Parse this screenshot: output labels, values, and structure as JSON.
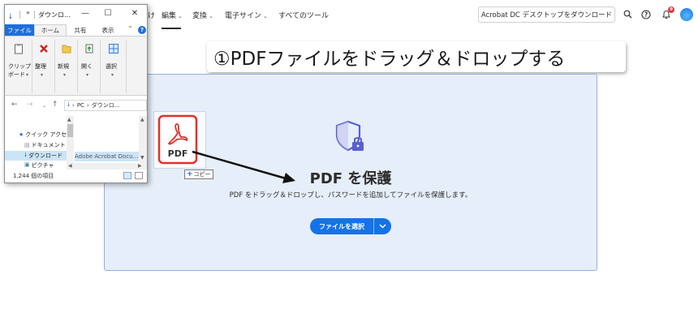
{
  "acrobat": {
    "cut_char": "け",
    "nav": {
      "edit": "編集",
      "convert": "変換",
      "esign": "電子サイン",
      "all_tools": "すべてのツール"
    },
    "download_button": "Acrobat DC デスクトップをダウンロード",
    "notification_count": "9",
    "accent_color": "#1473e6"
  },
  "step_caption": "①PDFファイルをドラッグ＆ドロップする",
  "dropzone": {
    "title": "PDF を保護",
    "subtitle": "PDF をドラッグ＆ドロップし、パスワードを追加してファイルを保護します。",
    "select_button": "ファイルを選択"
  },
  "drag": {
    "file_icon_label": "PDF",
    "copy_label": "コピー"
  },
  "explorer": {
    "qa_text": "»",
    "title": "ダウンロ...",
    "tabs": {
      "file": "ファイル",
      "home": "ホーム",
      "share": "共有",
      "view": "表示"
    },
    "ribbon": {
      "clipboard": "クリップ",
      "clipboard2": "ボード",
      "organize": "整理",
      "new": "新規",
      "open": "開く",
      "select": "選択"
    },
    "address": {
      "pc": "PC",
      "downloads": "ダウンロ..."
    },
    "nav_items": [
      "クイック アクセス",
      "ドキュメント",
      "ダウンロード",
      "ピクチャ"
    ],
    "file_item": "Adobe Acrobat Docu...",
    "status": "1,244 個の項目"
  }
}
